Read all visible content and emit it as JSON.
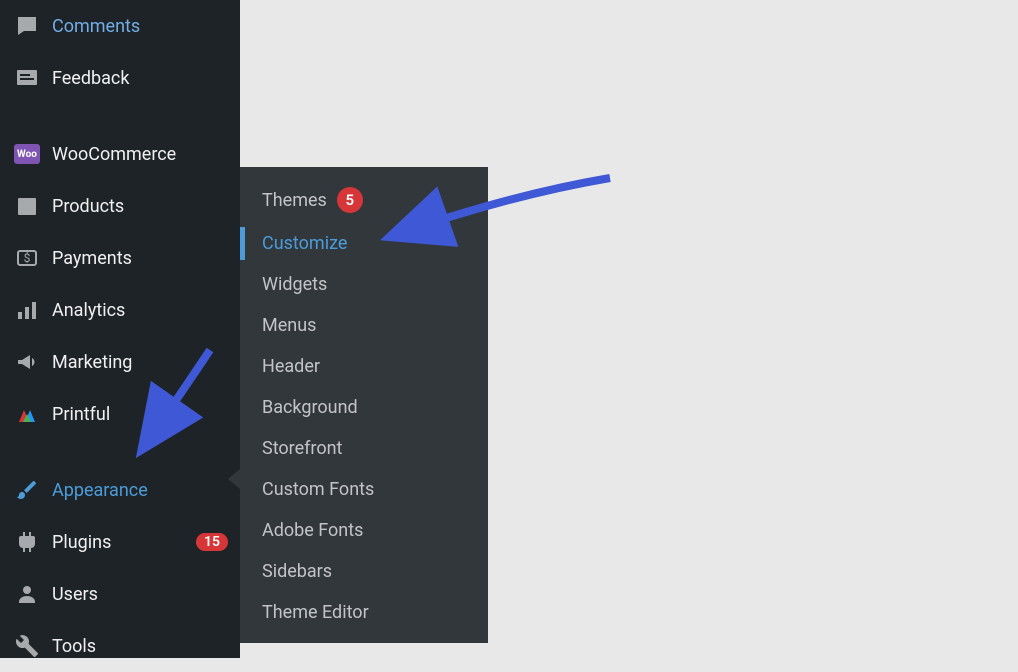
{
  "sidebar": {
    "items": [
      {
        "label": "Comments",
        "icon": "comment-icon"
      },
      {
        "label": "Feedback",
        "icon": "feedback-icon"
      },
      {
        "label": "WooCommerce",
        "icon": "woocommerce-icon"
      },
      {
        "label": "Products",
        "icon": "products-icon"
      },
      {
        "label": "Payments",
        "icon": "payments-icon"
      },
      {
        "label": "Analytics",
        "icon": "analytics-icon"
      },
      {
        "label": "Marketing",
        "icon": "marketing-icon"
      },
      {
        "label": "Printful",
        "icon": "printful-icon"
      },
      {
        "label": "Appearance",
        "icon": "appearance-icon",
        "active": true
      },
      {
        "label": "Plugins",
        "icon": "plugins-icon",
        "badge": "15"
      },
      {
        "label": "Users",
        "icon": "users-icon"
      },
      {
        "label": "Tools",
        "icon": "tools-icon"
      }
    ]
  },
  "submenu": {
    "items": [
      {
        "label": "Themes",
        "badge": "5"
      },
      {
        "label": "Customize",
        "highlighted": true
      },
      {
        "label": "Widgets"
      },
      {
        "label": "Menus"
      },
      {
        "label": "Header"
      },
      {
        "label": "Background"
      },
      {
        "label": "Storefront"
      },
      {
        "label": "Custom Fonts"
      },
      {
        "label": "Adobe Fonts"
      },
      {
        "label": "Sidebars"
      },
      {
        "label": "Theme Editor"
      }
    ]
  }
}
